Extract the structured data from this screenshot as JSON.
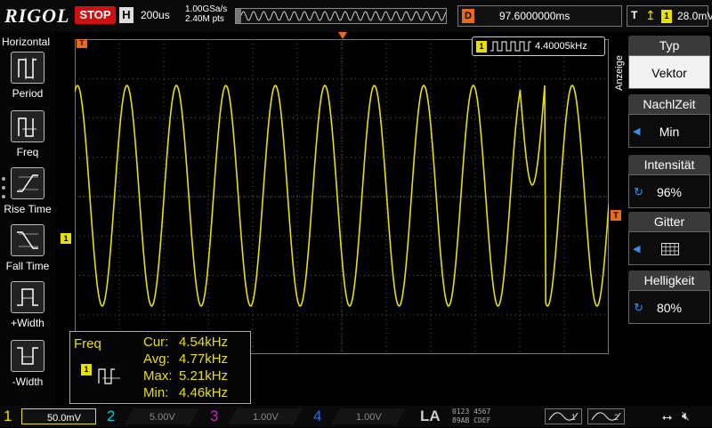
{
  "brand": "RIGOL",
  "topbar": {
    "run_state": "STOP",
    "horizontal_badge": "H",
    "timebase": "200us",
    "sample_rate": "1.00GSa/s",
    "memory_depth": "2.40M pts",
    "delay_badge": "D",
    "trigger_position": "97.6000000ms",
    "trigger_badge": "T",
    "trigger_channel": "1",
    "trigger_level": "28.0mV"
  },
  "left_menu": {
    "title": "Horizontal",
    "items": [
      {
        "label": "Period",
        "icon": "period-icon"
      },
      {
        "label": "Freq",
        "icon": "frequency-icon"
      },
      {
        "label": "Rise Time",
        "icon": "rise-time-icon"
      },
      {
        "label": "Fall Time",
        "icon": "fall-time-icon"
      },
      {
        "label": "+Width",
        "icon": "positive-width-icon"
      },
      {
        "label": "-Width",
        "icon": "negative-width-icon"
      }
    ]
  },
  "markers": {
    "trigger_time": "T",
    "ch1_offset": "1",
    "trigger_level": "T"
  },
  "freq_counter": {
    "channel": "1",
    "value": "4.40005kHz"
  },
  "measurement": {
    "name": "Freq",
    "channel": "1",
    "rows": [
      {
        "key": "Cur:",
        "value": "4.54kHz"
      },
      {
        "key": "Avg:",
        "value": "4.77kHz"
      },
      {
        "key": "Max:",
        "value": "5.21kHz"
      },
      {
        "key": "Min:",
        "value": "4.46kHz"
      }
    ]
  },
  "right_menu": {
    "tab": "Anzeige",
    "items": [
      {
        "title": "Typ",
        "value": "Vektor"
      },
      {
        "title": "NachlZeit",
        "value": "Min"
      },
      {
        "title": "Intensität",
        "value": "96%"
      },
      {
        "title": "Gitter",
        "value": ""
      },
      {
        "title": "Helligkeit",
        "value": "80%"
      }
    ]
  },
  "channels": [
    {
      "num": "1",
      "scale": "50.0mV",
      "color": "#e8e000",
      "active": true
    },
    {
      "num": "2",
      "scale": "5.00V",
      "color": "#00c8d0",
      "active": false
    },
    {
      "num": "3",
      "scale": "1.00V",
      "color": "#d020c0",
      "active": false
    },
    {
      "num": "4",
      "scale": "1.00V",
      "color": "#2a6ae8",
      "active": false
    }
  ],
  "logic_analyzer": {
    "label": "LA",
    "digits_row1": "0123 4567",
    "digits_row2": "89AB CDEF"
  },
  "generators": [
    {
      "num": "1"
    },
    {
      "num": "2"
    }
  ],
  "colors": {
    "trace": "#e8e000",
    "accent": "#e86a1a",
    "stop": "#d01010",
    "grid": "#555555"
  }
}
